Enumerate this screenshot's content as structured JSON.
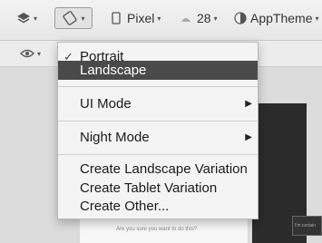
{
  "toolbar": {
    "device_value": "Pixel",
    "api_value": "28",
    "theme_value": "AppTheme"
  },
  "menu": {
    "orientation_items": [
      "Portrait",
      "Landscape"
    ],
    "checked_item": "Portrait",
    "selected_item": "Landscape",
    "ui_mode_label": "UI Mode",
    "night_mode_label": "Night Mode",
    "variation_items": [
      "Create Landscape Variation",
      "Create Tablet Variation",
      "Create Other..."
    ]
  },
  "canvas": {
    "preview_text": "Are you sure you want to do this?",
    "dark_preview_text": "I'm certain"
  }
}
